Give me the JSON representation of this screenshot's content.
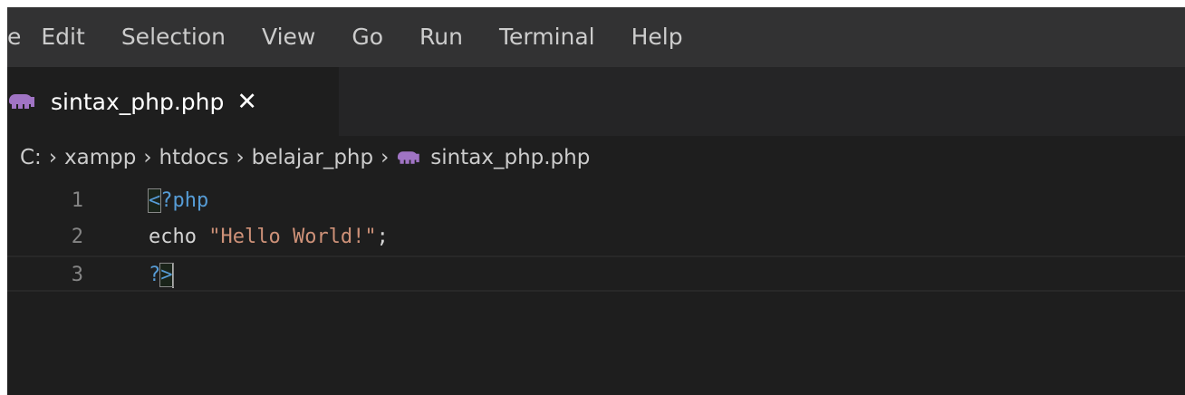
{
  "menubar": {
    "items": [
      "e",
      "Edit",
      "Selection",
      "View",
      "Go",
      "Run",
      "Terminal",
      "Help"
    ]
  },
  "tab": {
    "icon": "php-elephant-icon",
    "label": "sintax_php.php",
    "close": "✕"
  },
  "breadcrumb": {
    "items": [
      "C:",
      "xampp",
      "htdocs",
      "belajar_php",
      "sintax_php.php"
    ],
    "separator": "›"
  },
  "editor": {
    "lines": [
      {
        "number": "1",
        "open_bracket": "<",
        "tag_rest": "?php"
      },
      {
        "number": "2",
        "keyword": "echo",
        "string": "\"Hello World!\"",
        "semicolon": ";"
      },
      {
        "number": "3",
        "tag_q": "?",
        "close_bracket": ">"
      }
    ]
  },
  "colors": {
    "background": "#1e1e1e",
    "menubar": "#323233",
    "tag": "#569cd6",
    "string": "#ce9178",
    "php_icon": "#a074c4"
  }
}
